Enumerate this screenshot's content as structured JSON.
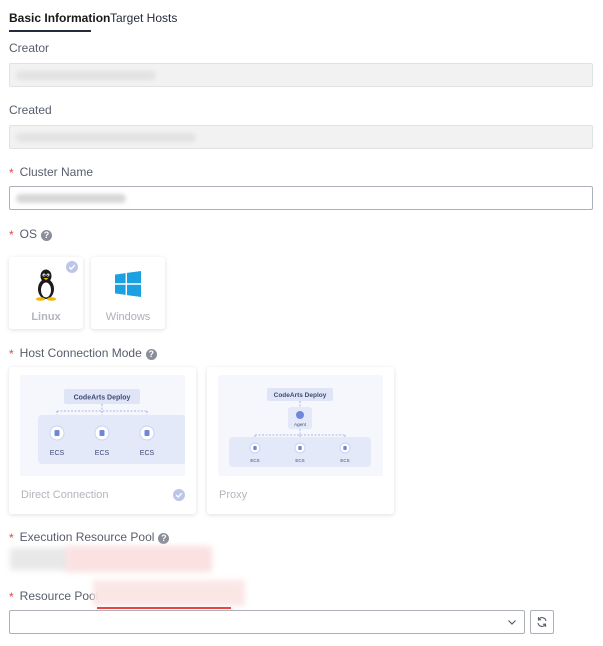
{
  "tabs": [
    {
      "label": "Basic Information",
      "active": true
    },
    {
      "label": "Target Hosts",
      "active": false
    }
  ],
  "form": {
    "required_mark": "*",
    "creator_label": "Creator",
    "created_label": "Created",
    "cluster_name_label": "Cluster Name",
    "os_label": "OS",
    "os_options": [
      {
        "label": "Linux",
        "icon": "linux-tux-icon",
        "selected": true
      },
      {
        "label": "Windows",
        "icon": "windows-logo-icon",
        "selected": false
      }
    ],
    "host_connection_label": "Host Connection Mode",
    "connection_modes": [
      {
        "label": "Direct Connection",
        "selected": true
      },
      {
        "label": "Proxy",
        "selected": false
      }
    ],
    "execution_pool_label": "Execution Resource Pool",
    "resource_pool_label": "Resource Pool",
    "help_glyph": "?"
  },
  "diagram_direct": {
    "header": "CodeArts Deploy",
    "nodes": [
      "ECS",
      "ECS",
      "ECS"
    ]
  },
  "diagram_proxy": {
    "header": "CodeArts Deploy",
    "agent": "Agent",
    "nodes": [
      "ECS",
      "ECS",
      "ECS"
    ]
  },
  "colors": {
    "accent": "#5e7ce0",
    "required": "#e54545",
    "check": "#bcc6e9"
  }
}
